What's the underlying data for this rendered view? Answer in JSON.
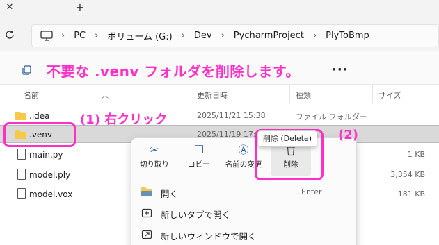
{
  "window": {
    "close_glyph": "✕",
    "new_tab_glyph": "+"
  },
  "address": {
    "refresh_icon": "refresh-icon",
    "crumbs": [
      "PC",
      "ボリューム (G:)",
      "Dev",
      "PycharmProject",
      "PlyToBmp"
    ],
    "separator": "›"
  },
  "toolbar": {
    "more_glyph": "···"
  },
  "annotations": {
    "title": "不要な .venv フォルダを削除します。",
    "step1": "(1) 右クリック",
    "step2": "(2)",
    "color": "#ff2fc8"
  },
  "columns": {
    "name": "名前",
    "date": "更新日時",
    "type": "種類",
    "size": "サイズ"
  },
  "files": [
    {
      "name": ".idea",
      "date": "2025/11/21 15:38",
      "type": "ファイル フォルダー",
      "size": "",
      "kind": "folder"
    },
    {
      "name": ".venv",
      "date": "2025/11/19 17:5",
      "type": "",
      "size": "",
      "kind": "folder",
      "selected": true
    },
    {
      "name": "main.py",
      "date": "",
      "type": "",
      "size": "1 KB",
      "kind": "file"
    },
    {
      "name": "model.ply",
      "date": "",
      "type": "",
      "size": "3,354 KB",
      "kind": "file"
    },
    {
      "name": "model.vox",
      "date": "",
      "type": "",
      "size": "181 KB",
      "kind": "file"
    }
  ],
  "context_menu": {
    "actions": [
      {
        "label": "切り取り",
        "icon": "cut-icon",
        "glyph": "✂"
      },
      {
        "label": "コピー",
        "icon": "copy-icon",
        "glyph": "❐"
      },
      {
        "label": "名前の変更",
        "icon": "rename-icon",
        "glyph": "Ⓐ"
      },
      {
        "label": "削除",
        "icon": "delete-icon",
        "glyph": "🗑"
      }
    ],
    "items": [
      {
        "label": "開く",
        "shortcut": "Enter",
        "icon": "open-folder-icon"
      },
      {
        "label": "新しいタブで開く",
        "shortcut": "",
        "icon": "new-tab-icon"
      },
      {
        "label": "新しいウィンドウで開く",
        "shortcut": "",
        "icon": "new-window-icon"
      }
    ],
    "tooltip": "削除 (Delete)"
  },
  "colors": {
    "folder": "#f7c948",
    "accent": "#2f5f9e",
    "selection": "#d9d9d9"
  }
}
